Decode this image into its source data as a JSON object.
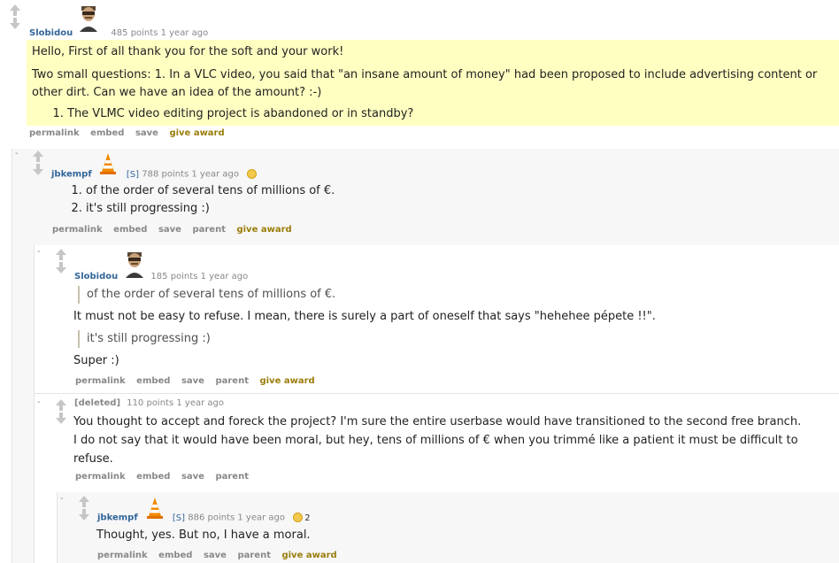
{
  "comments": [
    {
      "author": "Slobidou",
      "points": "485 points",
      "time": "1 year ago",
      "paragraphs": [
        "Hello, First of all thank you for the soft and your work!",
        "Two small questions: 1. In a VLC video, you said that \"an insane amount of money\" had been proposed to include advertising content or other dirt. Can we have an idea of the amount? :-)"
      ],
      "list": [
        "The VLMC video editing project is abandoned or in standby?"
      ],
      "buttons": [
        "permalink",
        "embed",
        "save"
      ],
      "award_label": "give award"
    },
    {
      "author": "jbkempf",
      "flair": "[S]",
      "points": "788 points",
      "time": "1 year ago",
      "list": [
        "of the order of several tens of millions of €.",
        "it's still progressing :)"
      ],
      "buttons": [
        "permalink",
        "embed",
        "save",
        "parent"
      ],
      "award_label": "give award"
    },
    {
      "author": "Slobidou",
      "points": "185 points",
      "time": "1 year ago",
      "quote1": "of the order of several tens of millions of €.",
      "text1": "It must not be easy to refuse. I mean, there is surely a part of oneself that says \"hehehee pépete !!\".",
      "quote2": "it's still progressing :)",
      "text2": "Super :)",
      "buttons": [
        "permalink",
        "embed",
        "save",
        "parent"
      ],
      "award_label": "give award"
    },
    {
      "author": "[deleted]",
      "points": "110 points",
      "time": "1 year ago",
      "text": "You thought to accept and foreck the project? I'm sure the entire userbase would have transitioned to the second free branch. I do not say that it would have been moral, but hey, tens of millions of € when you trimmé like a patient it must be difficult to refuse.",
      "buttons": [
        "permalink",
        "embed",
        "save",
        "parent"
      ]
    },
    {
      "author": "jbkempf",
      "flair": "[S]",
      "points": "886 points",
      "time": "1 year ago",
      "award_count": "2",
      "text": "Thought, yes. But no, I have a moral.",
      "buttons": [
        "permalink",
        "embed",
        "save",
        "parent"
      ],
      "award_label": "give award"
    }
  ],
  "collapse_label": "-",
  "icons": {
    "vote_up": "upvote-arrow-icon",
    "vote_down": "downvote-arrow-icon",
    "award": "gold-award-icon",
    "cone": "vlc-cone-icon",
    "avatar": "user-avatar-icon"
  }
}
